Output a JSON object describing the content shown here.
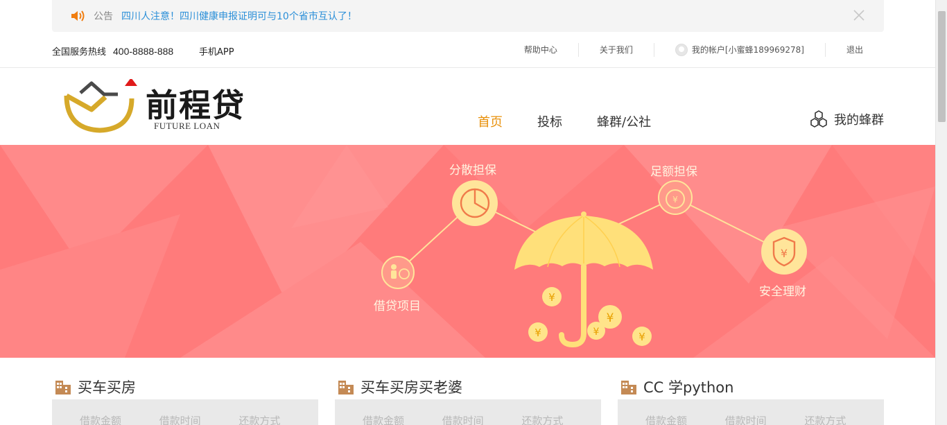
{
  "notice": {
    "label": "公告",
    "text": "四川人注意！四川健康申报证明可与10个省市互认了！"
  },
  "topbar": {
    "hotline_label": "全国服务热线",
    "hotline_number": "400-8888-888",
    "app_label": "手机APP",
    "help": "帮助中心",
    "about": "关于我们",
    "account": "我的帐户[小蜜蜂189969278]",
    "logout": "退出"
  },
  "logo": {
    "brand": "前程贷",
    "brand_en": "FUTURE LOAN"
  },
  "nav": {
    "items": [
      {
        "label": "首页",
        "active": true
      },
      {
        "label": "投标",
        "active": false
      },
      {
        "label": "蜂群/公社",
        "active": false
      }
    ],
    "my_swarm": "我的蜂群"
  },
  "banner": {
    "features": [
      {
        "label": "分散担保",
        "icon": "pie-chart-icon"
      },
      {
        "label": "足额担保",
        "icon": "money-bag-icon"
      },
      {
        "label": "借贷项目",
        "icon": "person-coin-icon"
      },
      {
        "label": "安全理财",
        "icon": "shield-yen-icon"
      }
    ],
    "colors": {
      "background": "#ff7a7a",
      "umbrella": "#ffe07a",
      "coin": "#ffe48a"
    }
  },
  "cards": [
    {
      "title": "买车买房",
      "cols": [
        "借款金额",
        "借款时间",
        "还款方式"
      ]
    },
    {
      "title": "买车买房买老婆",
      "cols": [
        "借款金额",
        "借款时间",
        "还款方式"
      ]
    },
    {
      "title": "CC 学python",
      "cols": [
        "借款金额",
        "借款时间",
        "还款方式"
      ]
    }
  ],
  "colors": {
    "accent": "#e8900a",
    "link": "#2b8fd8"
  }
}
